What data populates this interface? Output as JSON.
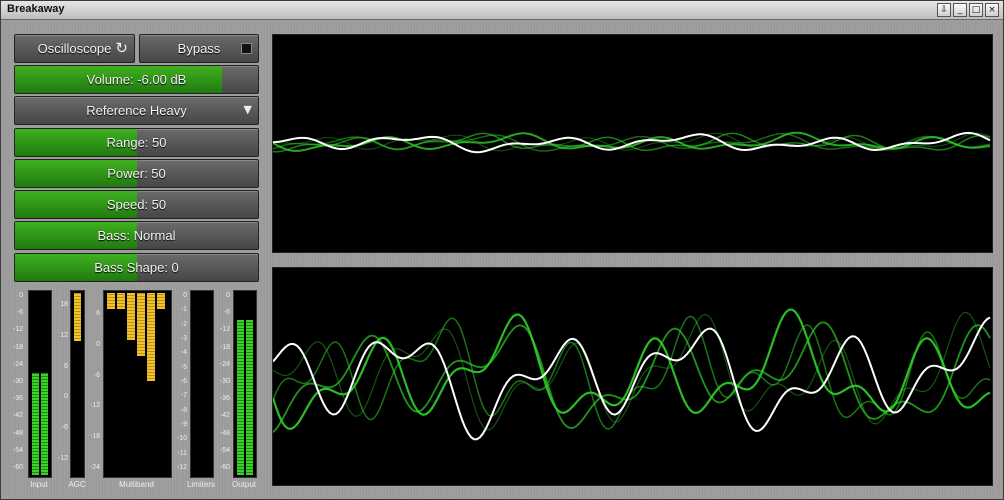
{
  "window": {
    "title": "Breakaway",
    "buttons": [
      "⇩",
      "_",
      "□",
      "×"
    ]
  },
  "controls": {
    "oscilloscope_label": "Oscilloscope",
    "bypass_label": "Bypass",
    "volume": {
      "label": "Volume: -6.00 dB",
      "level": 0.85
    },
    "preset": {
      "label": "Reference Heavy"
    },
    "range": {
      "label": "Range: 50",
      "level": 0.5
    },
    "power": {
      "label": "Power: 50",
      "level": 0.5
    },
    "speed": {
      "label": "Speed: 50",
      "level": 0.5
    },
    "bass": {
      "label": "Bass: Normal",
      "level": 0.5
    },
    "bass_shape": {
      "label": "Bass Shape: 0",
      "level": 0.5
    }
  },
  "meters": {
    "input": {
      "label": "Input",
      "ticks": [
        "0",
        "-6",
        "-12",
        "-18",
        "-24",
        "-30",
        "-36",
        "-42",
        "-48",
        "-54",
        "-60"
      ],
      "levels": [
        0.56,
        0.56
      ]
    },
    "agc": {
      "label": "AGC",
      "ticks": [
        "18",
        "12",
        "6",
        "0",
        "-6",
        "-12"
      ],
      "level_db": 12
    },
    "multiband": {
      "label": "Multiband",
      "ticks": [
        "6",
        "0",
        "-6",
        "-12",
        "-18",
        "-24"
      ],
      "bars_db": [
        7.5,
        7.5,
        1.5,
        -1.5,
        -6.5,
        7.5
      ]
    },
    "limiters": {
      "label": "Limiters",
      "ticks": [
        "0",
        "-1",
        "-2",
        "-3",
        "-4",
        "-5",
        "-6",
        "-7",
        "-8",
        "-9",
        "-10",
        "-11",
        "-12"
      ]
    },
    "output": {
      "label": "Output",
      "ticks": [
        "0",
        "-6",
        "-12",
        "-18",
        "-24",
        "-30",
        "-36",
        "-42",
        "-48",
        "-54",
        "-60"
      ],
      "levels": [
        0.85,
        0.85
      ]
    }
  },
  "colors": {
    "accent_green": "#2e9a16",
    "wave_green": "#2fd12a",
    "wave_white": "#ffffff",
    "meter_yellow": "#f2c42a"
  },
  "icons": {
    "refresh": "refresh-icon",
    "bypass_indicator": "square-icon",
    "dropdown": "chevron-down-icon"
  }
}
